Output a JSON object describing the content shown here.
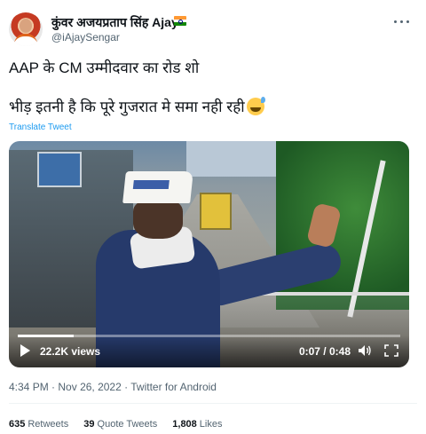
{
  "author": {
    "display_name": "कुंवर अजयप्रताप सिंह Ajay",
    "handle": "@iAjaySengar",
    "flag_icon": "india-flag-icon"
  },
  "tweet": {
    "line1": "AAP के CM उम्मीदवार का रोड शो",
    "line2": "भीड़ इतनी है कि पूरे गुजरात मे समा नही रही",
    "emoji": "grinning-face-with-sweat-emoji",
    "translate_label": "Translate Tweet"
  },
  "video": {
    "views": "22.2K views",
    "time": "0:07 / 0:48",
    "progress": 0.146
  },
  "meta": {
    "time": "4:34 PM",
    "sep1": "·",
    "date": "Nov 26, 2022",
    "sep2": "·",
    "client": "Twitter for Android"
  },
  "stats": {
    "retweets_count": "635",
    "retweets_label": "Retweets",
    "quotes_count": "39",
    "quotes_label": "Quote Tweets",
    "likes_count": "1,808",
    "likes_label": "Likes"
  },
  "colors": {
    "link": "#1d9bf0",
    "secondary": "#536471",
    "primary": "#0f1419"
  }
}
